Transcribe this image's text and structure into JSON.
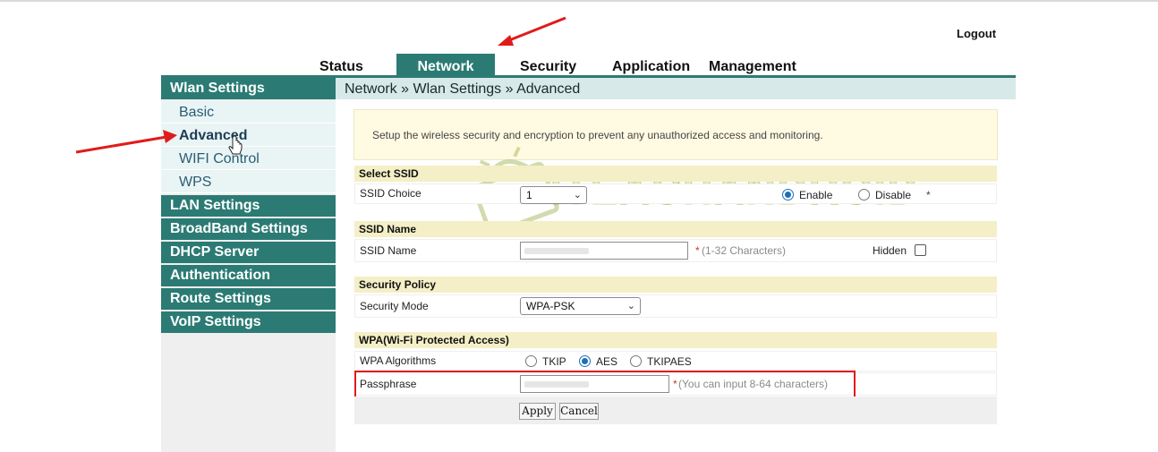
{
  "header": {
    "logout_label": "Logout"
  },
  "nav": {
    "tabs": [
      {
        "label": "Status",
        "active": false
      },
      {
        "label": "Network",
        "active": true
      },
      {
        "label": "Security",
        "active": false
      },
      {
        "label": "Application",
        "active": false
      },
      {
        "label": "Management",
        "active": false
      }
    ]
  },
  "sidebar": {
    "groups": [
      {
        "label": "Wlan Settings",
        "expanded": true,
        "items": [
          {
            "label": "Basic",
            "active": false
          },
          {
            "label": "Advanced",
            "active": true
          },
          {
            "label": "WIFI Control",
            "active": false
          },
          {
            "label": "WPS",
            "active": false
          }
        ]
      },
      {
        "label": "LAN Settings"
      },
      {
        "label": "BroadBand Settings"
      },
      {
        "label": "DHCP Server"
      },
      {
        "label": "Authentication"
      },
      {
        "label": "Route Settings"
      },
      {
        "label": "VoIP Settings"
      }
    ]
  },
  "breadcrumb": "Network » Wlan Settings » Advanced",
  "intro_text": "Setup the wireless security and encryption to prevent any unauthorized access and monitoring.",
  "select_ssid": {
    "heading": "Select SSID",
    "label": "SSID Choice",
    "value": "1",
    "enable_label": "Enable",
    "disable_label": "Disable",
    "enabled": true,
    "star": "*"
  },
  "ssid_name": {
    "heading": "SSID Name",
    "label": "SSID Name",
    "hint": "(1-32 Characters)",
    "star": "*",
    "hidden_label": "Hidden",
    "hidden_checked": false
  },
  "security_policy": {
    "heading": "Security Policy",
    "label": "Security Mode",
    "value": "WPA-PSK"
  },
  "wpa": {
    "heading": "WPA(Wi-Fi Protected Access)",
    "algorithms_label": "WPA Algorithms",
    "options": [
      "TKIP",
      "AES",
      "TKIPAES"
    ],
    "selected": "AES",
    "passphrase_label": "Passphrase",
    "passphrase_star": "*",
    "passphrase_hint": "(You can input 8-64 characters)"
  },
  "buttons": {
    "apply": "Apply",
    "cancel": "Cancel"
  },
  "watermark": "ITEACHANDROID",
  "colors": {
    "accent": "#2b7b74",
    "section_header": "#f4efc6",
    "intro_bg": "#fffbe3",
    "highlight": "#e01b1b"
  }
}
